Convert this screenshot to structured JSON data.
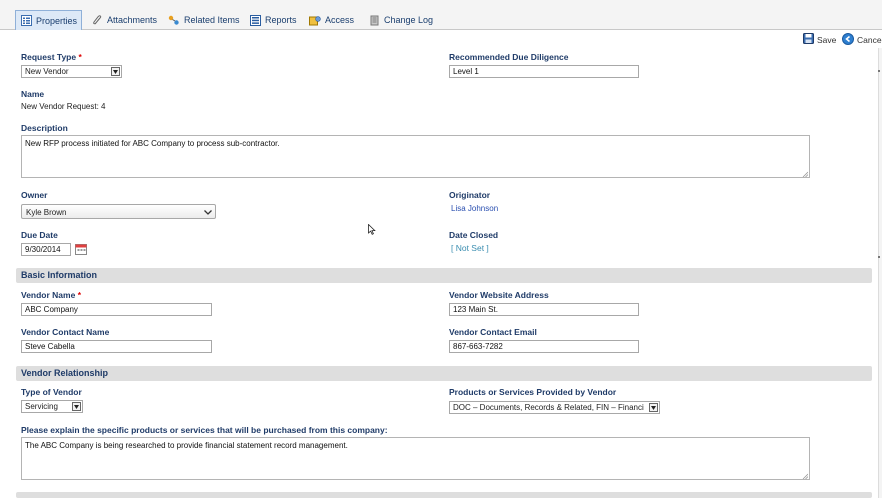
{
  "tabs": [
    {
      "label": "Properties",
      "icon": "properties-icon"
    },
    {
      "label": "Attachments",
      "icon": "paperclip-icon"
    },
    {
      "label": "Related Items",
      "icon": "related-items-icon"
    },
    {
      "label": "Reports",
      "icon": "reports-icon"
    },
    {
      "label": "Access",
      "icon": "access-icon"
    },
    {
      "label": "Change Log",
      "icon": "change-log-icon"
    }
  ],
  "actions": {
    "save": "Save",
    "cancel": "Cancel"
  },
  "form": {
    "request_type": {
      "label": "Request Type",
      "value": "New Vendor"
    },
    "recommended_due_diligence": {
      "label": "Recommended Due Diligence",
      "value": "Level 1"
    },
    "name": {
      "label": "Name",
      "value": "New Vendor Request: 4"
    },
    "description": {
      "label": "Description",
      "value": "New RFP process initiated for ABC Company to process sub-contractor."
    },
    "owner": {
      "label": "Owner",
      "value": "Kyle Brown"
    },
    "originator": {
      "label": "Originator",
      "value": "Lisa Johnson"
    },
    "due_date": {
      "label": "Due Date",
      "value": "9/30/2014"
    },
    "date_closed": {
      "label": "Date Closed",
      "value": "[ Not Set ]"
    }
  },
  "basic_info": {
    "title": "Basic Information",
    "vendor_name": {
      "label": "Vendor Name",
      "value": "ABC Company"
    },
    "vendor_website": {
      "label": "Vendor Website Address",
      "value": "123 Main St."
    },
    "vendor_contact_name": {
      "label": "Vendor Contact Name",
      "value": "Steve Cabella"
    },
    "vendor_contact_email": {
      "label": "Vendor Contact Email",
      "value": "867-663-7282"
    }
  },
  "vendor_relationship": {
    "title": "Vendor Relationship",
    "type_of_vendor": {
      "label": "Type of Vendor",
      "value": "Servicing"
    },
    "products_services": {
      "label": "Products or Services Provided by Vendor",
      "value": "DOC – Documents, Records & Related, FIN – Financi"
    },
    "explain": {
      "label": "Please explain the specific products or services that will be purchased from this company:",
      "value": "The ABC Company is being researched to provide financial statement record management."
    }
  },
  "required_mark": "*",
  "colors": {
    "label": "#1f3b68",
    "required": "#dd0000",
    "link": "#2a4fb0",
    "section_bg": "#dedede"
  }
}
